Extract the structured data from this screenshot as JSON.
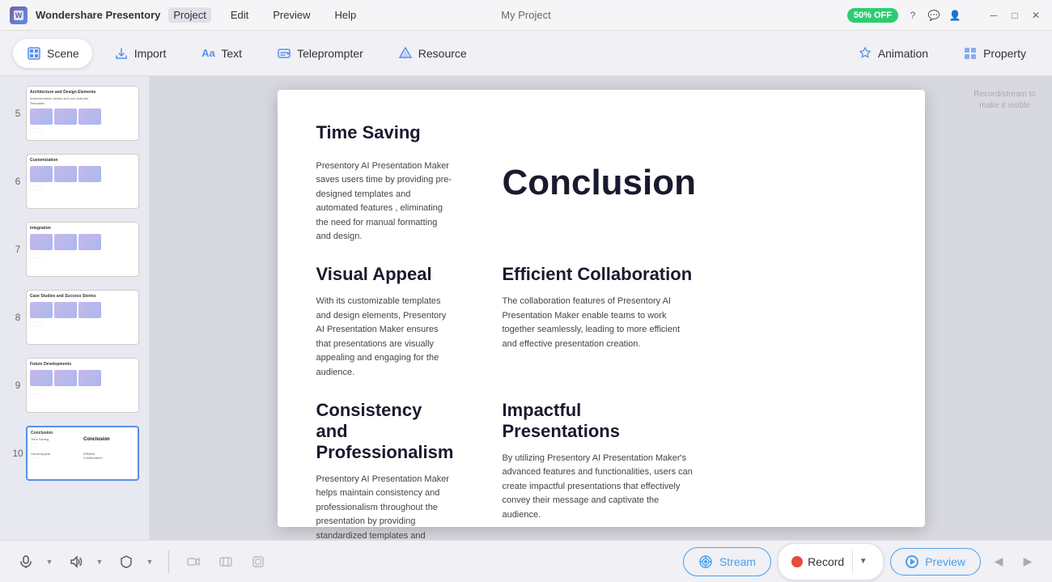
{
  "app": {
    "name": "Wondershare Presentory",
    "logo_char": "W",
    "title": "My Project",
    "sale_badge": "50% OFF"
  },
  "menu": {
    "items": [
      "Project",
      "Edit",
      "Preview",
      "Help"
    ],
    "active": "Project"
  },
  "toolbar": {
    "buttons": [
      {
        "id": "scene",
        "label": "Scene",
        "icon": "⬛",
        "active": true
      },
      {
        "id": "import",
        "label": "Import",
        "icon": "📥",
        "active": false
      },
      {
        "id": "text",
        "label": "Text",
        "icon": "Aa",
        "active": false
      },
      {
        "id": "teleprompter",
        "label": "Teleprompter",
        "icon": "💬",
        "active": false
      },
      {
        "id": "resource",
        "label": "Resource",
        "icon": "🔷",
        "active": false
      },
      {
        "id": "animation",
        "label": "Animation",
        "icon": "✨",
        "active": false
      },
      {
        "id": "property",
        "label": "Property",
        "icon": "🏠",
        "active": false
      }
    ]
  },
  "slides": [
    {
      "num": "5",
      "title": "Architecture and Design Elements",
      "has_images": true
    },
    {
      "num": "6",
      "title": "Customization",
      "has_images": true
    },
    {
      "num": "7",
      "title": "Integration",
      "has_images": true
    },
    {
      "num": "8",
      "title": "Case Studies and Success Stories",
      "has_images": true
    },
    {
      "num": "9",
      "title": "Future Developments",
      "has_images": true
    },
    {
      "num": "10",
      "title": "Conclusion",
      "has_images": false,
      "active": true
    }
  ],
  "canvas": {
    "watermark_line1": "Record/stream to",
    "watermark_line2": "make it visible",
    "sections": [
      {
        "id": "time-saving",
        "title": "Time Saving",
        "body": "Presentory AI Presentation Maker saves users time by providing pre-designed templates and automated features , eliminating the need for manual formatting and design.",
        "position": "top-left"
      },
      {
        "id": "conclusion",
        "title": "Conclusion",
        "position": "top-right",
        "is_heading": true
      },
      {
        "id": "visual-appeal",
        "title": "Visual Appeal",
        "body": "With its customizable templates and design elements, Presentory AI Presentation Maker ensures that presentations are visually appealing and engaging for the audience.",
        "position": "mid-left"
      },
      {
        "id": "efficient-collaboration",
        "title": "Efficient Collaboration",
        "body": "The collaboration features of Presentory AI Presentation Maker enable teams to work together seamlessly, leading to more efficient and effective presentation creation.",
        "position": "mid-right"
      },
      {
        "id": "consistency",
        "title": "Consistency and Professionalism",
        "body": "Presentory AI Presentation Maker helps maintain consistency and professionalism throughout the presentation by providing standardized templates and design guidelines.",
        "position": "bot-left"
      },
      {
        "id": "impactful",
        "title": "Impactful Presentations",
        "body": "By utilizing Presentory AI Presentation Maker's advanced features and functionalities, users can create impactful presentations that effectively convey their message and captivate the audience.",
        "position": "bot-right"
      }
    ]
  },
  "bottom_bar": {
    "stream_label": "Stream",
    "record_label": "Record",
    "preview_label": "Preview"
  }
}
